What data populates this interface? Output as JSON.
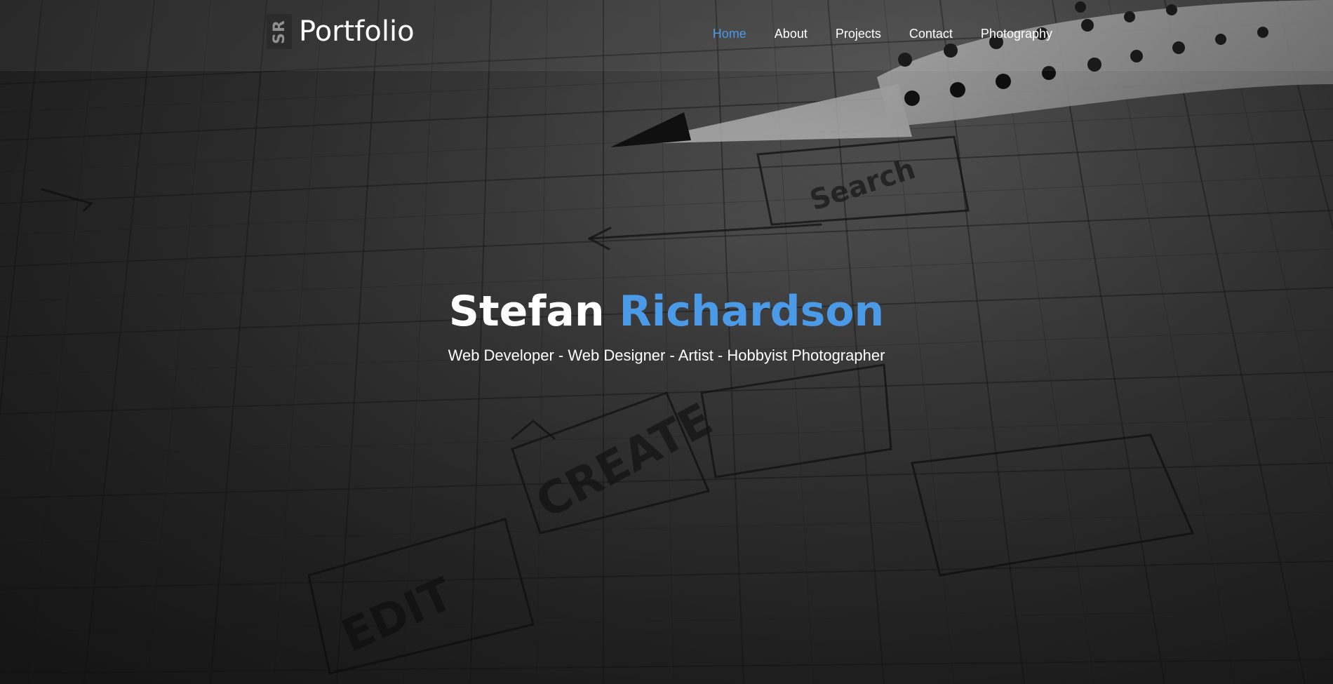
{
  "brand": {
    "mark": "SR",
    "name": "Portfolio"
  },
  "nav": {
    "items": [
      {
        "label": "Home",
        "active": true
      },
      {
        "label": "About",
        "active": false
      },
      {
        "label": "Projects",
        "active": false
      },
      {
        "label": "Contact",
        "active": false
      },
      {
        "label": "Photography",
        "active": false
      }
    ]
  },
  "hero": {
    "first_name": "Stefan",
    "last_name": "Richardson",
    "tagline": "Web Developer - Web Designer - Artist - Hobbyist Photographer",
    "background_image": "pencil-sketch-on-grid-paper"
  },
  "colors": {
    "accent": "#4a9ae8",
    "text": "#ffffff",
    "background": "#2f2f2f"
  }
}
